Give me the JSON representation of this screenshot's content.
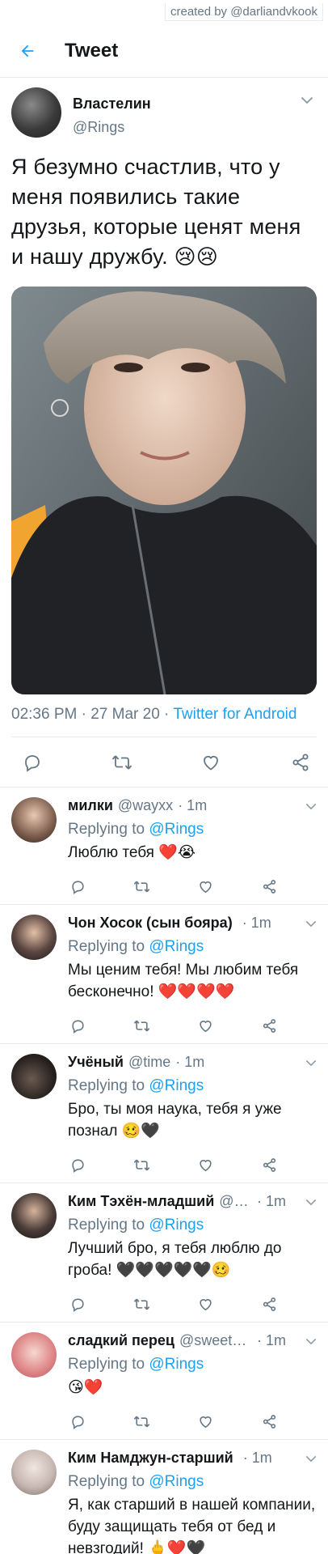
{
  "credit": "created by @darliandvkook",
  "header": {
    "title": "Tweet"
  },
  "colors": {
    "accent": "#1da1f2",
    "muted": "#657786",
    "text": "#14171a",
    "divider": "#e6ecf0"
  },
  "tweet": {
    "name": "Властелин",
    "handle": "@Rings",
    "text": "Я безумно счастлив, что у меня появились такие друзья, которые ценят меня и нашу дружбу.",
    "emoji": "😢😢",
    "time_date": "02:36 PM · 27 Mar 20 · ",
    "source": "Twitter for Android"
  },
  "icons": {
    "back": "arrow-left-icon",
    "more": "chevron-down-icon",
    "reply": "reply-icon",
    "retweet": "retweet-icon",
    "like": "heart-icon",
    "share": "share-icon"
  },
  "replies": [
    {
      "name": "милки",
      "handle": "@wayxx",
      "time": "· 1m",
      "replying_label": "Replying to",
      "mention": "@Rings",
      "text": "Люблю тебя ❤️😭"
    },
    {
      "name": "Чон Хосок (сын боярa)",
      "handle": "",
      "time": "· 1m",
      "replying_label": "Replying to",
      "mention": "@Rings",
      "text": "Мы ценим тебя! Мы любим тебя бесконечно! ❤️❤️❤️❤️"
    },
    {
      "name": "Учёный",
      "handle": "@time",
      "time": "· 1m",
      "replying_label": "Replying to",
      "mention": "@Rings",
      "text": "Бро, ты моя наука, тебя я уже познал 🥴🖤"
    },
    {
      "name": "Ким Тэхён-младший",
      "handle": "@1…",
      "time": "· 1m",
      "replying_label": "Replying to",
      "mention": "@Rings",
      "text": "Лучший бро, я тебя люблю до гроба! 🖤🖤🖤🖤🖤🥴"
    },
    {
      "name": "сладкий перец",
      "handle": "@sweet_…",
      "time": "· 1m",
      "replying_label": "Replying to",
      "mention": "@Rings",
      "text": "😘❤️"
    },
    {
      "name": "Ким Намджун-старший",
      "handle": "",
      "time": "· 1m",
      "replying_label": "Replying to",
      "mention": "@Rings",
      "text": "Я, как старший в нашей компании, буду защищать тебя от бед и невзгодий! 🖕❤️🖤"
    }
  ]
}
